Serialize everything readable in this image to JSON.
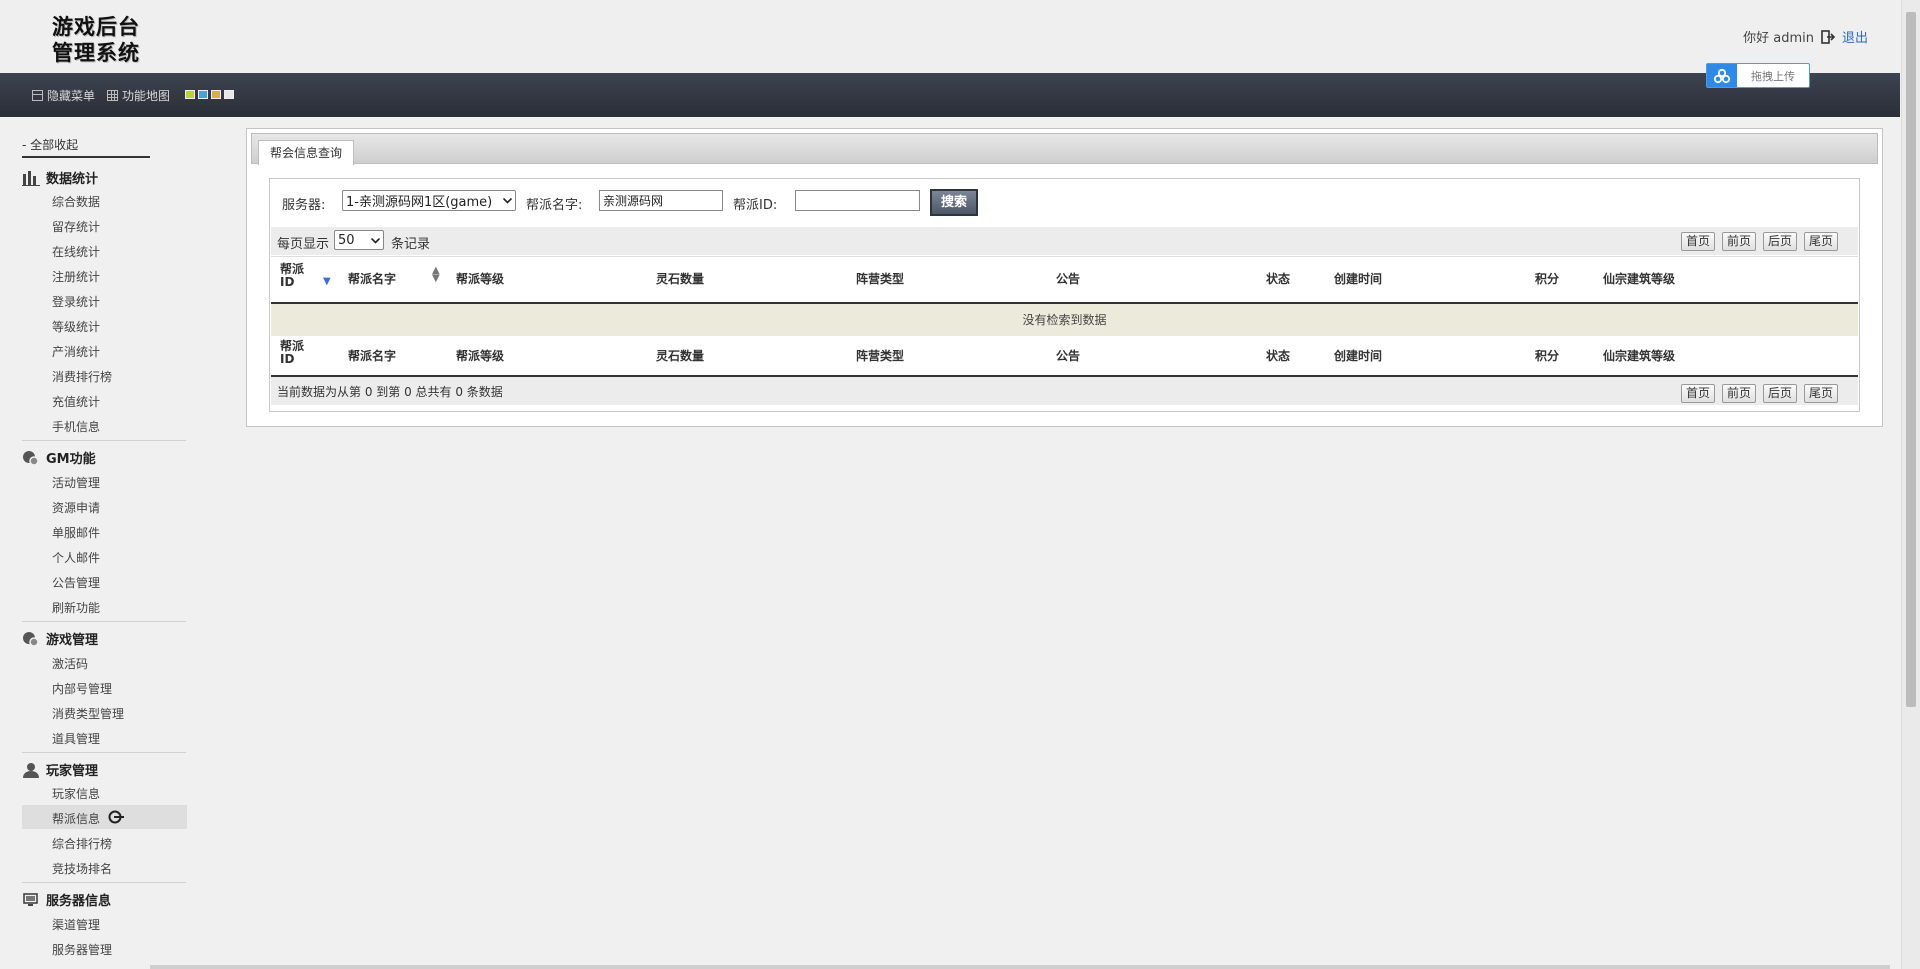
{
  "header": {
    "logo_line1": "游戏后台",
    "logo_line2": "管理系统",
    "greeting": "你好 admin",
    "logout": "退出"
  },
  "toolbar": {
    "hide_menu": "隐藏菜单",
    "function_map": "功能地图",
    "theme_colors": [
      "#b9d23a",
      "#3fa6d6",
      "#d6b146",
      "#e8e8e8"
    ],
    "upload_label": "拖拽上传"
  },
  "sidebar": {
    "collapse_all": "- 全部收起",
    "groups": [
      {
        "title": "数据统计",
        "icon": "bar-chart-icon",
        "items": [
          "综合数据",
          "留存统计",
          "在线统计",
          "注册统计",
          "登录统计",
          "等级统计",
          "产消统计",
          "消费排行榜",
          "充值统计",
          "手机信息"
        ]
      },
      {
        "title": "GM功能",
        "icon": "gm-icon",
        "items": [
          "活动管理",
          "资源申请",
          "单服邮件",
          "个人邮件",
          "公告管理",
          "刷新功能"
        ]
      },
      {
        "title": "游戏管理",
        "icon": "game-icon",
        "items": [
          "激活码",
          "内部号管理",
          "消费类型管理",
          "道具管理"
        ]
      },
      {
        "title": "玩家管理",
        "icon": "user-icon",
        "items": [
          "玩家信息",
          "帮派信息",
          "综合排行榜",
          "竞技场排名"
        ]
      },
      {
        "title": "服务器信息",
        "icon": "server-icon",
        "items": [
          "渠道管理",
          "服务器管理"
        ]
      }
    ],
    "active_item": "帮派信息"
  },
  "main": {
    "tab_label": "帮会信息查询",
    "filters": {
      "server_label": "服务器:",
      "server_value": "1-亲测源码网1区(game)",
      "guild_name_label": "帮派名字:",
      "guild_name_value": "亲测源码网",
      "guild_id_label": "帮派ID:",
      "guild_id_value": "",
      "search_button": "搜索"
    },
    "page_size": {
      "prefix": "每页显示",
      "value": "50",
      "suffix": "条记录"
    },
    "pagination": [
      "首页",
      "前页",
      "后页",
      "尾页"
    ],
    "columns": [
      "帮派ID",
      "帮派名字",
      "帮派等级",
      "灵石数量",
      "阵营类型",
      "公告",
      "状态",
      "创建时间",
      "积分",
      "仙宗建筑等级"
    ],
    "empty_message": "没有检索到数据",
    "summary": "当前数据为从第 0 到第 0 总共有 0 条数据"
  }
}
